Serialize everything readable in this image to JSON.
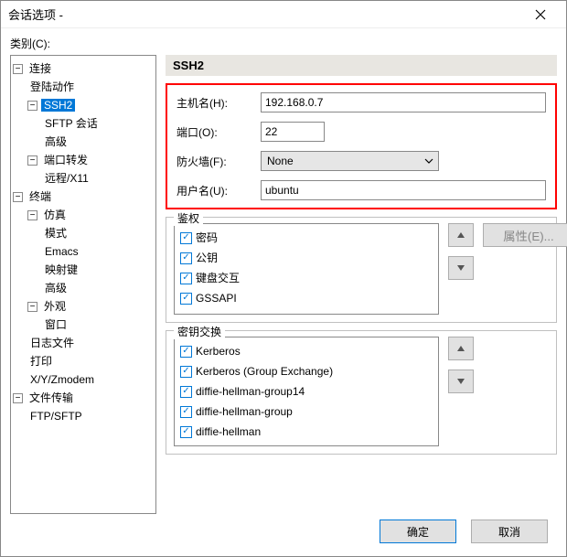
{
  "window": {
    "title": "会话选项 -"
  },
  "category_label": "类别(C):",
  "tree": {
    "connection": {
      "label": "连接"
    },
    "login_action": {
      "label": "登陆动作"
    },
    "ssh2": {
      "label": "SSH2"
    },
    "sftp_session": {
      "label": "SFTP 会话"
    },
    "advanced1": {
      "label": "高级"
    },
    "port_forward": {
      "label": "端口转发"
    },
    "remote_x11": {
      "label": "远程/X11"
    },
    "terminal": {
      "label": "终端"
    },
    "emulation": {
      "label": "仿真"
    },
    "modes": {
      "label": "模式"
    },
    "emacs": {
      "label": "Emacs"
    },
    "keymap": {
      "label": "映射键"
    },
    "advanced2": {
      "label": "高级"
    },
    "appearance": {
      "label": "外观"
    },
    "window_item": {
      "label": "窗口"
    },
    "log_files": {
      "label": "日志文件"
    },
    "print": {
      "label": "打印"
    },
    "xyz": {
      "label": "X/Y/Zmodem"
    },
    "file_transfer": {
      "label": "文件传输"
    },
    "ftp_sftp": {
      "label": "FTP/SFTP"
    }
  },
  "section": {
    "header": "SSH2"
  },
  "form": {
    "host_label": "主机名(H):",
    "host_value": "192.168.0.7",
    "port_label": "端口(O):",
    "port_value": "22",
    "firewall_label": "防火墙(F):",
    "firewall_value": "None",
    "user_label": "用户名(U):",
    "user_value": "ubuntu"
  },
  "auth": {
    "legend": "鉴权",
    "props_button": "属性(E)...",
    "items": [
      {
        "label": "密码",
        "checked": true
      },
      {
        "label": "公钥",
        "checked": true
      },
      {
        "label": "键盘交互",
        "checked": true
      },
      {
        "label": "GSSAPI",
        "checked": true
      }
    ]
  },
  "kex": {
    "legend": "密钥交换",
    "items": [
      {
        "label": "Kerberos",
        "checked": true
      },
      {
        "label": "Kerberos (Group Exchange)",
        "checked": true
      },
      {
        "label": "diffie-hellman-group14",
        "checked": true
      },
      {
        "label": "diffie-hellman-group",
        "checked": true
      },
      {
        "label": "diffie-hellman",
        "checked": true
      }
    ]
  },
  "footer": {
    "ok": "确定",
    "cancel": "取消"
  }
}
